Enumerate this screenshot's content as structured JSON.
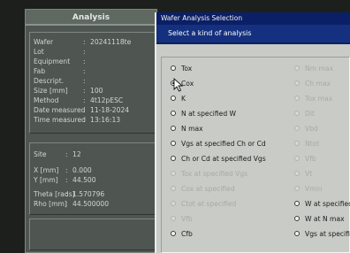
{
  "panel": {
    "title": "Analysis",
    "info": [
      {
        "key": "Wafer",
        "value": "20241118te"
      },
      {
        "key": "Lot",
        "value": ""
      },
      {
        "key": "Equipment",
        "value": ""
      },
      {
        "key": "Fab",
        "value": ""
      },
      {
        "key": "Descript.",
        "value": ""
      },
      {
        "key": "Size [mm]",
        "value": "100"
      },
      {
        "key": "Method",
        "value": "4t12pESC"
      },
      {
        "key": "Date measured",
        "value": "11-18-2024"
      },
      {
        "key": "Time measured",
        "value": "13:16:13"
      }
    ],
    "site": [
      {
        "key": "Site",
        "value": "12"
      },
      {
        "key": "X [mm]",
        "value": "0.000"
      },
      {
        "key": "Y [mm]",
        "value": "44.500"
      },
      {
        "key": "Theta [rads]",
        "value": "1.570796"
      },
      {
        "key": "Rho [mm]",
        "value": "44.500000"
      }
    ]
  },
  "dialog": {
    "title": "Wafer Analysis Selection",
    "subtitle": "Select a kind of analysis",
    "left_options": [
      {
        "label": "Tox",
        "enabled": true,
        "selected": false
      },
      {
        "label": "Cox",
        "enabled": true,
        "selected": true
      },
      {
        "label": "K",
        "enabled": true,
        "selected": false
      },
      {
        "label": "N at specified W",
        "enabled": true,
        "selected": false
      },
      {
        "label": "N max",
        "enabled": true,
        "selected": false
      },
      {
        "label": "Vgs at specified Ch or Cd",
        "enabled": true,
        "selected": false
      },
      {
        "label": "Ch or Cd at specified Vgs",
        "enabled": true,
        "selected": false
      },
      {
        "label": "Tox at specified Vgs",
        "enabled": false,
        "selected": false
      },
      {
        "label": "Cox at specified",
        "enabled": false,
        "selected": false
      },
      {
        "label": "Ctot at specified",
        "enabled": false,
        "selected": false
      },
      {
        "label": "Vfb",
        "enabled": false,
        "selected": false
      },
      {
        "label": "Cfb",
        "enabled": true,
        "selected": false
      }
    ],
    "right_options": [
      {
        "label": "Nm max",
        "enabled": false
      },
      {
        "label": "Ch max",
        "enabled": false
      },
      {
        "label": "Tox max",
        "enabled": false
      },
      {
        "label": "Dit",
        "enabled": false
      },
      {
        "label": "Vbd",
        "enabled": false
      },
      {
        "label": "Ntot",
        "enabled": false
      },
      {
        "label": "Vfb",
        "enabled": false
      },
      {
        "label": "Vt",
        "enabled": false
      },
      {
        "label": "Vmin",
        "enabled": false
      },
      {
        "label": "W at specified",
        "enabled": true
      },
      {
        "label": "W at N max",
        "enabled": true
      },
      {
        "label": "Vgs at specified",
        "enabled": true
      }
    ]
  }
}
